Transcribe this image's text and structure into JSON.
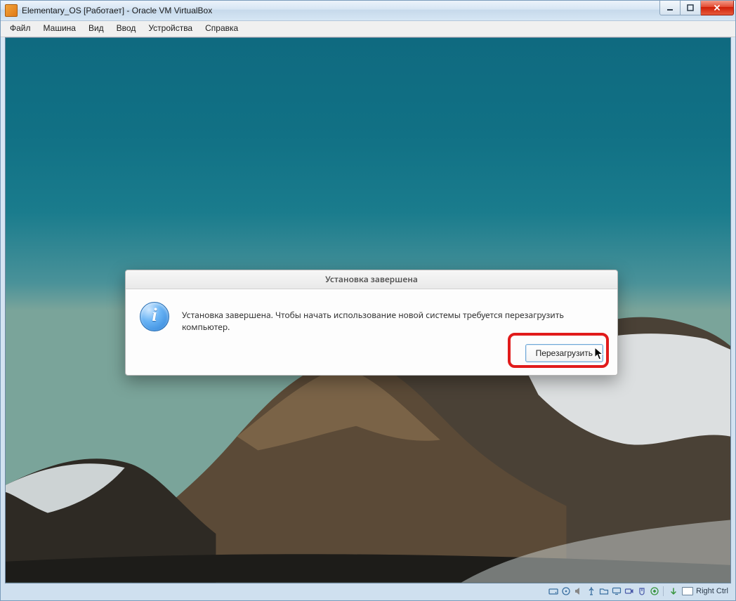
{
  "window": {
    "title": "Elementary_OS [Работает] - Oracle VM VirtualBox"
  },
  "menu": {
    "items": [
      "Файл",
      "Машина",
      "Вид",
      "Ввод",
      "Устройства",
      "Справка"
    ]
  },
  "dialog": {
    "title": "Установка завершена",
    "message": "Установка завершена. Чтобы начать использование новой системы требуется перезагрузить компьютер.",
    "restart_label": "Перезагрузить"
  },
  "statusbar": {
    "hostkey": "Right Ctrl",
    "icons": [
      "harddisk-icon",
      "optical-disc-icon",
      "audio-icon",
      "usb-icon",
      "shared-folder-icon",
      "display-icon",
      "video-capture-icon",
      "mouse-integration-icon",
      "keyboard-capture-icon"
    ]
  }
}
